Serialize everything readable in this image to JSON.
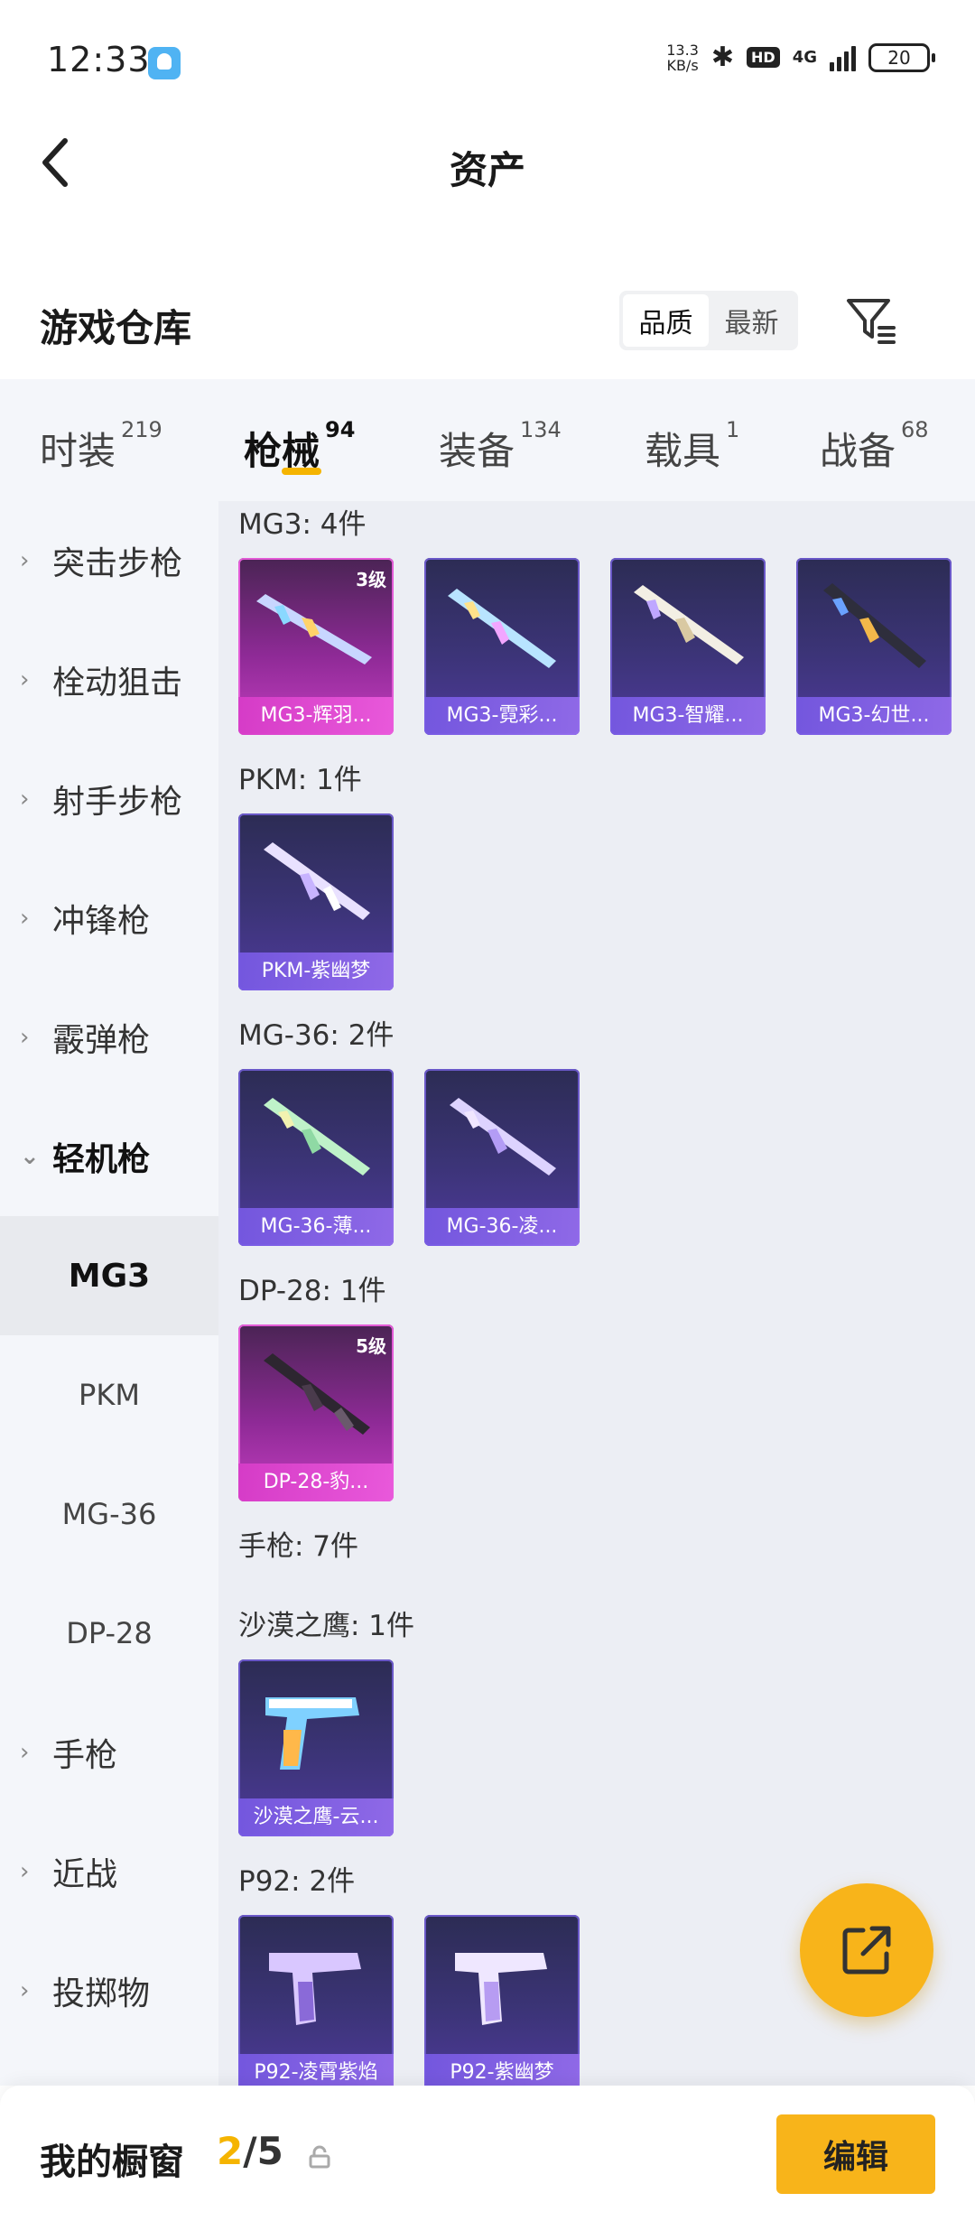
{
  "status_bar": {
    "time": "12:33",
    "net_speed_value": "13.3",
    "net_speed_unit": "KB/s",
    "hd": "HD",
    "network": "4G",
    "battery": "20"
  },
  "nav": {
    "title": "资产"
  },
  "warehouse": {
    "title": "游戏仓库",
    "sort_options": [
      "品质",
      "最新"
    ],
    "sort_selected": "品质"
  },
  "tabs": [
    {
      "label": "时装",
      "count": "219"
    },
    {
      "label": "枪械",
      "count": "94",
      "active": true
    },
    {
      "label": "装备",
      "count": "134"
    },
    {
      "label": "载具",
      "count": "1"
    },
    {
      "label": "战备",
      "count": "68"
    }
  ],
  "sidebar": {
    "categories": [
      "突击步枪",
      "栓动狙击",
      "射手步枪",
      "冲锋枪",
      "霰弹枪",
      "轻机枪"
    ],
    "subcategories": [
      "MG3",
      "PKM",
      "MG-36",
      "DP-28"
    ],
    "selected_sub": "MG3",
    "more_categories": [
      "手枪",
      "近战",
      "投掷物"
    ]
  },
  "groups": [
    {
      "label": "MG3: 4件",
      "items": [
        {
          "name": "MG3-辉羽...",
          "level": "3级",
          "tier": "pink"
        },
        {
          "name": "MG3-霓彩...",
          "tier": "purple"
        },
        {
          "name": "MG3-智耀...",
          "tier": "purple"
        },
        {
          "name": "MG3-幻世...",
          "tier": "purple"
        }
      ]
    },
    {
      "label": "PKM: 1件",
      "items": [
        {
          "name": "PKM-紫幽梦",
          "tier": "purple"
        }
      ]
    },
    {
      "label": "MG-36: 2件",
      "items": [
        {
          "name": "MG-36-薄...",
          "tier": "purple"
        },
        {
          "name": "MG-36-凌...",
          "tier": "purple"
        }
      ]
    },
    {
      "label": "DP-28: 1件",
      "items": [
        {
          "name": "DP-28-豹...",
          "level": "5级",
          "tier": "pink"
        }
      ]
    },
    {
      "label": "手枪: 7件",
      "items": []
    },
    {
      "label": "沙漠之鹰: 1件",
      "items": [
        {
          "name": "沙漠之鹰-云...",
          "tier": "purple"
        }
      ]
    },
    {
      "label": "P92: 2件",
      "items": [
        {
          "name": "P92-凌霄紫焰",
          "tier": "purple"
        },
        {
          "name": "P92-紫幽梦",
          "tier": "purple"
        }
      ]
    }
  ],
  "bottom_bar": {
    "label": "我的橱窗",
    "current": "2",
    "separator": "/",
    "total": "5",
    "edit_label": "编辑"
  },
  "colors": {
    "accent": "#f8b41a",
    "purple_card": "#3c3478",
    "pink_card": "#c43ec0"
  }
}
